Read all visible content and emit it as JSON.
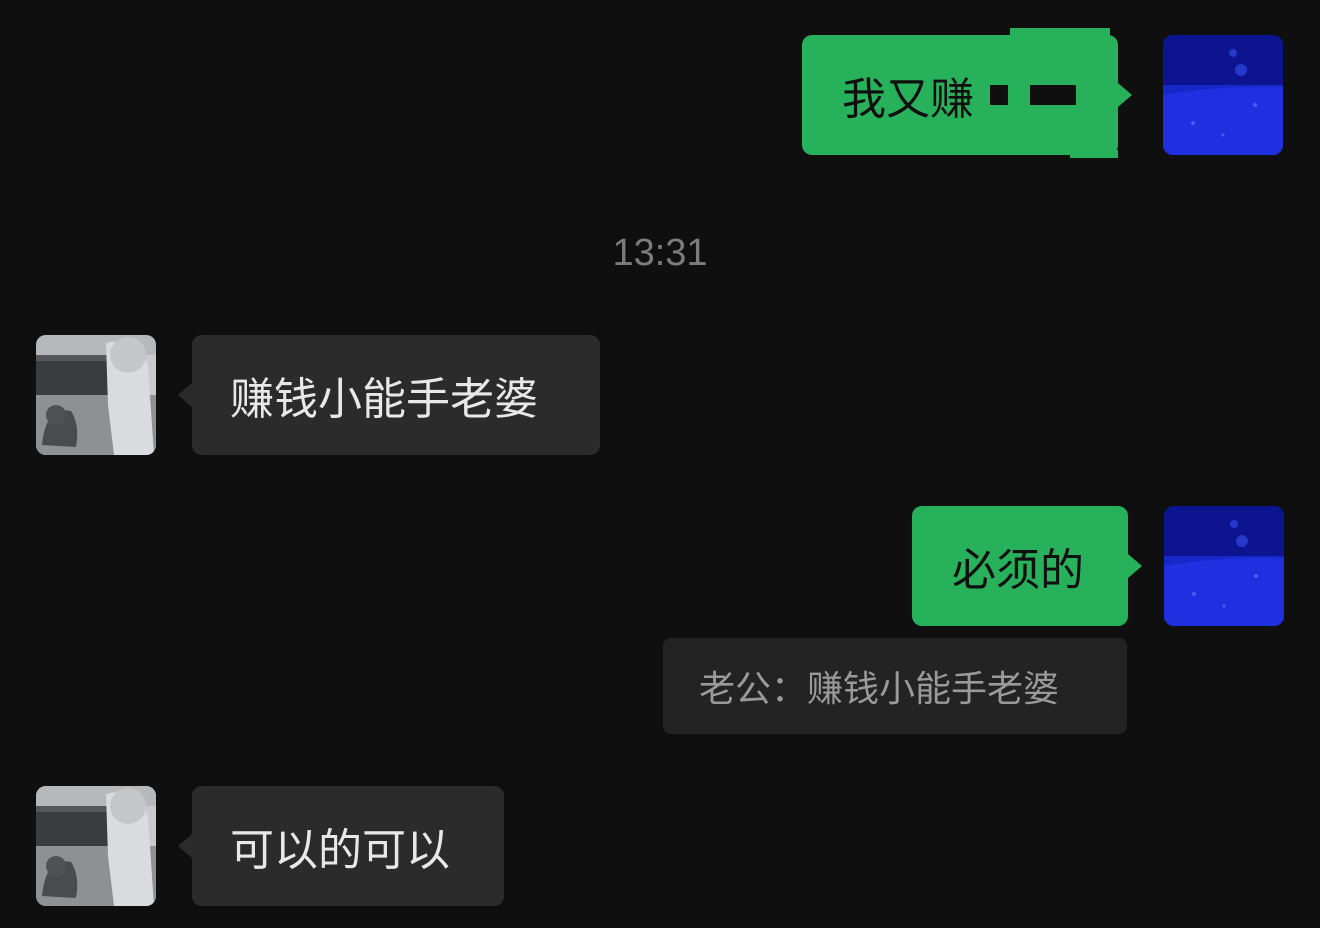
{
  "timestamp": "13:31",
  "messages": [
    {
      "side": "out",
      "text": "我又赚"
    },
    {
      "side": "in",
      "text": "赚钱小能手老婆"
    },
    {
      "side": "out",
      "text": "必须的"
    },
    {
      "side": "in",
      "text": "可以的可以"
    }
  ],
  "quote": {
    "text": "老公：赚钱小能手老婆"
  },
  "colors": {
    "background": "#0f0f10",
    "outgoing_bubble": "#28b15b",
    "incoming_bubble": "#2b2b2c",
    "quote_bubble": "#232324",
    "timestamp_text": "#7c7c7c"
  }
}
